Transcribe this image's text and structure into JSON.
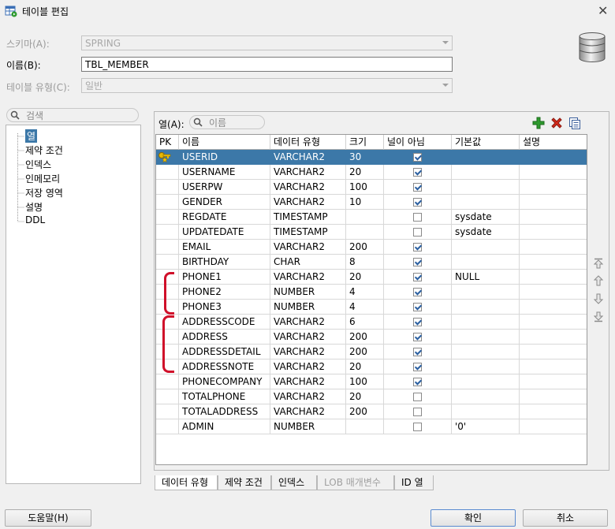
{
  "window": {
    "title": "테이블 편집",
    "close_glyph": "✕"
  },
  "form": {
    "schema_label": "스키마(A):",
    "schema_value": "SPRING",
    "name_label": "이름(B):",
    "name_value": "TBL_MEMBER",
    "type_label": "테이블 유형(C):",
    "type_value": "일반"
  },
  "left": {
    "search_placeholder": "검색",
    "tree": [
      "열",
      "제약 조건",
      "인덱스",
      "인메모리",
      "저장 영역",
      "설명",
      "DDL"
    ]
  },
  "columns_panel": {
    "label": "열(A):",
    "search_placeholder": "이름",
    "headers": [
      "PK",
      "이름",
      "데이터 유형",
      "크기",
      "널이 아님",
      "기본값",
      "설명"
    ],
    "rows": [
      {
        "pk": true,
        "name": "USERID",
        "type": "VARCHAR2",
        "size": "30",
        "notnull": true,
        "default": "",
        "desc": ""
      },
      {
        "pk": false,
        "name": "USERNAME",
        "type": "VARCHAR2",
        "size": "20",
        "notnull": true,
        "default": "",
        "desc": ""
      },
      {
        "pk": false,
        "name": "USERPW",
        "type": "VARCHAR2",
        "size": "100",
        "notnull": true,
        "default": "",
        "desc": ""
      },
      {
        "pk": false,
        "name": "GENDER",
        "type": "VARCHAR2",
        "size": "10",
        "notnull": true,
        "default": "",
        "desc": ""
      },
      {
        "pk": false,
        "name": "REGDATE",
        "type": "TIMESTAMP",
        "size": "",
        "notnull": false,
        "default": "sysdate",
        "desc": ""
      },
      {
        "pk": false,
        "name": "UPDATEDATE",
        "type": "TIMESTAMP",
        "size": "",
        "notnull": false,
        "default": "sysdate",
        "desc": ""
      },
      {
        "pk": false,
        "name": "EMAIL",
        "type": "VARCHAR2",
        "size": "200",
        "notnull": true,
        "default": "",
        "desc": ""
      },
      {
        "pk": false,
        "name": "BIRTHDAY",
        "type": "CHAR",
        "size": "8",
        "notnull": true,
        "default": "",
        "desc": ""
      },
      {
        "pk": false,
        "name": "PHONE1",
        "type": "VARCHAR2",
        "size": "20",
        "notnull": true,
        "default": "NULL",
        "desc": ""
      },
      {
        "pk": false,
        "name": "PHONE2",
        "type": "NUMBER",
        "size": "4",
        "notnull": true,
        "default": "",
        "desc": ""
      },
      {
        "pk": false,
        "name": "PHONE3",
        "type": "NUMBER",
        "size": "4",
        "notnull": true,
        "default": "",
        "desc": ""
      },
      {
        "pk": false,
        "name": "ADDRESSCODE",
        "type": "VARCHAR2",
        "size": "6",
        "notnull": true,
        "default": "",
        "desc": ""
      },
      {
        "pk": false,
        "name": "ADDRESS",
        "type": "VARCHAR2",
        "size": "200",
        "notnull": true,
        "default": "",
        "desc": ""
      },
      {
        "pk": false,
        "name": "ADDRESSDETAIL",
        "type": "VARCHAR2",
        "size": "200",
        "notnull": true,
        "default": "",
        "desc": ""
      },
      {
        "pk": false,
        "name": "ADDRESSNOTE",
        "type": "VARCHAR2",
        "size": "20",
        "notnull": true,
        "default": "",
        "desc": ""
      },
      {
        "pk": false,
        "name": "PHONECOMPANY",
        "type": "VARCHAR2",
        "size": "100",
        "notnull": true,
        "default": "",
        "desc": ""
      },
      {
        "pk": false,
        "name": "TOTALPHONE",
        "type": "VARCHAR2",
        "size": "20",
        "notnull": false,
        "default": "",
        "desc": ""
      },
      {
        "pk": false,
        "name": "TOTALADDRESS",
        "type": "VARCHAR2",
        "size": "200",
        "notnull": false,
        "default": "",
        "desc": ""
      },
      {
        "pk": false,
        "name": "ADMIN",
        "type": "NUMBER",
        "size": "",
        "notnull": false,
        "default": "'0'",
        "desc": ""
      }
    ],
    "selected_row": 0
  },
  "bottom_tabs": [
    "데이터 유형",
    "제약 조건",
    "인덱스",
    "LOB 매개변수",
    "ID 열"
  ],
  "buttons": {
    "help": "도움말(H)",
    "ok": "확인",
    "cancel": "취소"
  },
  "colors": {
    "selection": "#3c78a8",
    "add": "#2e9a2e",
    "delete": "#d42a1a",
    "annotation": "#d0102a"
  }
}
